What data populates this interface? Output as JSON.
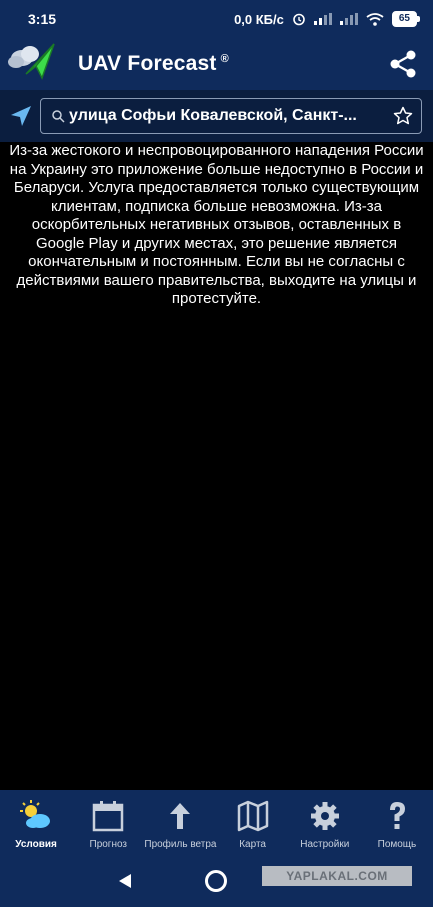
{
  "status_bar": {
    "time": "3:15",
    "speed": "0,0 КБ/с",
    "battery": "65"
  },
  "app_bar": {
    "title": "UAV Forecast",
    "registered_mark": "®"
  },
  "search": {
    "value": "улица Софьи Ковалевской, Санкт-..."
  },
  "notice": {
    "text": "Из-за жестокого и неспровоцированного нападения России на Украину это приложение больше недоступно в России и Беларуси. Услуга предоставляется только существующим клиентам, подписка больше невозможна. Из-за оскорбительных негативных отзывов, оставленных в Google Play и других местах, это решение является окончательным и постоянным. Если вы не согласны с действиями вашего правительства, выходите на улицы и протестуйте."
  },
  "bottom_nav": {
    "items": [
      {
        "label": "Условия",
        "icon": "weather-icon",
        "active": true
      },
      {
        "label": "Прогноз",
        "icon": "calendar-icon",
        "active": false
      },
      {
        "label": "Профиль ветра",
        "icon": "arrow-up-icon",
        "active": false
      },
      {
        "label": "Карта",
        "icon": "map-icon",
        "active": false
      },
      {
        "label": "Настройки",
        "icon": "gear-icon",
        "active": false
      },
      {
        "label": "Помощь",
        "icon": "question-icon",
        "active": false
      }
    ]
  },
  "watermark": "YAPLAKAL.COM",
  "colors": {
    "bar": "#0f2b5c",
    "search_row": "#0b1e3f",
    "accent_green": "#3ddc4a",
    "active_icon": "#5ec8ff"
  }
}
